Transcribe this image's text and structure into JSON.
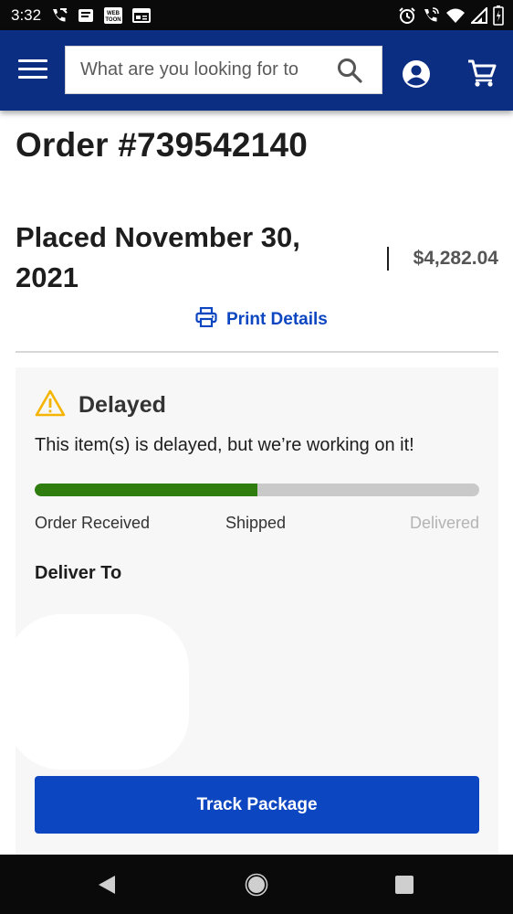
{
  "status_bar": {
    "time": "3:32",
    "left_icons": [
      "phone-call-icon",
      "message-icon",
      "webtoon-icon",
      "news-icon"
    ],
    "right_icons": [
      "alarm-icon",
      "wifi-call-icon",
      "wifi-icon",
      "signal-icon",
      "battery-icon"
    ],
    "webtoon_text": "WEB TOON"
  },
  "header": {
    "search_placeholder": "What are you looking for to",
    "brand_color": "#0b2e82"
  },
  "order": {
    "title": "Order #739542140",
    "placed": "Placed November 30, 2021",
    "total": "$4,282.04",
    "print_label": "Print Details"
  },
  "status_card": {
    "status_title": "Delayed",
    "message": "This item(s) is delayed, but we’re working on it!",
    "progress_fraction": 0.5,
    "steps": [
      "Order Received",
      "Shipped",
      "Delivered"
    ],
    "deliver_to_label": "Deliver To",
    "track_button": "Track Package",
    "colors": {
      "progress": "#2f7d0f",
      "warning": "#f5b400",
      "button": "#0d46c1"
    }
  },
  "nav_bar": {
    "icons": [
      "back-icon",
      "home-icon",
      "recents-icon"
    ]
  }
}
